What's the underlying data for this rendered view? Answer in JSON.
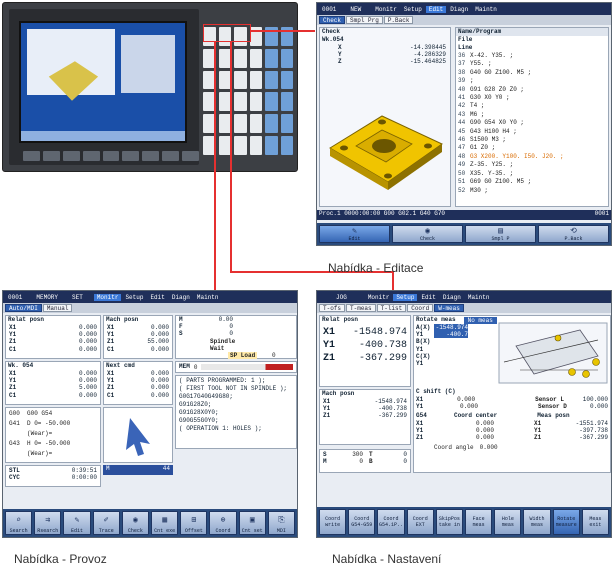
{
  "captions": {
    "edit": "Nabídka - Editace",
    "operation": "Nabídka - Provoz",
    "setup": "Nabídka - Nastavení"
  },
  "edit_screen": {
    "topbar": [
      "0001",
      "",
      "NEW",
      "",
      "Monitr",
      "Setup",
      "Edit",
      "Diagn",
      "Maintn"
    ],
    "tabs": [
      "Check",
      "Smpl Prg",
      "P.Back"
    ],
    "mode": "Check",
    "wk": "Wk.054",
    "coords": [
      {
        "axis": "X",
        "value": "-14.398445"
      },
      {
        "axis": "Y",
        "value": "-4.286329"
      },
      {
        "axis": "Z",
        "value": "-15.464825"
      }
    ],
    "file_header": "Name/Program",
    "file_label": "File",
    "line_label": "Line",
    "program_lines": [
      {
        "no": "36",
        "text": "X-42. Y35. ;"
      },
      {
        "no": "37",
        "text": "Y55. ;"
      },
      {
        "no": "38",
        "text": "G40 G0 Z100. M5 ;"
      },
      {
        "no": "39",
        "text": ";"
      },
      {
        "no": "40",
        "text": "G91 G28 Z0 Z0 ;"
      },
      {
        "no": "41",
        "text": "G30 X0 Y0 ;"
      },
      {
        "no": "42",
        "text": "T4 ;"
      },
      {
        "no": "43",
        "text": "M6 ;"
      },
      {
        "no": "44",
        "text": "G90 G54 X0 Y0 ;"
      },
      {
        "no": "45",
        "text": "G43 H100 H4 ;"
      },
      {
        "no": "46",
        "text": "S1500 M3 ;"
      },
      {
        "no": "47",
        "text": "G1 Z0 ;"
      },
      {
        "no": "48",
        "text": "G3 X200. Y100. I50. J20. ;",
        "highlight": true
      },
      {
        "no": "49",
        "text": "Z-35. Y25. ;"
      },
      {
        "no": "50",
        "text": "X35. Y-35. ;"
      },
      {
        "no": "51",
        "text": "G69 G0 Z100. M5 ;"
      },
      {
        "no": "52",
        "text": "M30 ;"
      }
    ],
    "status": "Proc.1  0000:00:00 G00 G02.1 G40 G70",
    "status_tail": "0001",
    "softkeys": [
      {
        "icon": "edit-icon",
        "label": "Edit"
      },
      {
        "icon": "check-icon",
        "label": "Check"
      },
      {
        "icon": "simple-program-icon",
        "label": "Smpl P"
      },
      {
        "icon": "playback-icon",
        "label": "P.Back"
      }
    ]
  },
  "operation_screen": {
    "topbar": [
      "0001",
      "",
      "MEMORY",
      "",
      "SET",
      "",
      "Monitr",
      "Setup",
      "Edit",
      "Diagn",
      "Maintn"
    ],
    "tabs": [
      "Auto/MDI",
      "Manual"
    ],
    "relat_title": "Relat posn",
    "relat": [
      {
        "axis": "X1",
        "value": "0.000"
      },
      {
        "axis": "Y1",
        "value": "0.000"
      },
      {
        "axis": "Z1",
        "value": "0.000"
      },
      {
        "axis": "C1",
        "value": "0.000"
      }
    ],
    "mach_title": "Mach posn",
    "mach": [
      {
        "axis": "X1",
        "value": "0.000"
      },
      {
        "axis": "Y1",
        "value": "0.000"
      },
      {
        "axis": "Z1",
        "value": "55.000"
      },
      {
        "axis": "C1",
        "value": "0.000"
      }
    ],
    "wk_title": "Wk. 054",
    "wk": [
      {
        "axis": "X1",
        "value": "0.000"
      },
      {
        "axis": "Y1",
        "value": "0.000"
      },
      {
        "axis": "Z1",
        "value": "5.000"
      },
      {
        "axis": "C1",
        "value": "0.000"
      }
    ],
    "next_title": "Next cmd",
    "next": [
      {
        "axis": "X1",
        "value": "0.000"
      },
      {
        "axis": "Y1",
        "value": "0.000"
      },
      {
        "axis": "Z1",
        "value": "0.000"
      },
      {
        "axis": "C1",
        "value": "0.000"
      }
    ],
    "feed": [
      {
        "k": "M",
        "v": "0.00"
      },
      {
        "k": "F",
        "v": "0"
      },
      {
        "k": "S",
        "v": "0"
      }
    ],
    "spindle_label": "Spindle",
    "wait_label": "Wait",
    "spload_label": "SP Load",
    "spload_value": "0",
    "mem_label": "MEM",
    "mem_value": "0",
    "modal_lines": [
      {
        "l": "G00",
        "r": "G00 G54"
      },
      {
        "l": "G41",
        "r": "D 0=   -50.000"
      },
      {
        "l": "",
        "r": "(Wear)="
      },
      {
        "l": "G43",
        "r": "H 0=   -50.000"
      },
      {
        "l": "",
        "r": "(Wear)="
      }
    ],
    "stl": {
      "label": "STL",
      "value": "0:39:51"
    },
    "cyc": {
      "label": "CYC",
      "value": "0:00:00"
    },
    "count": {
      "label": "M",
      "value": "44"
    },
    "program_text": [
      "( PARTS PROGRAMMED: 1 );",
      "( FIRST TOOL NOT IN SPINDLE );",
      "G0G17G40G49G80;",
      "G91G28Z0;",
      "G91G28X0Y0;",
      "G90G55G0Y0;",
      "( OPERATION 1: HOLES );"
    ],
    "softkeys": [
      {
        "icon": "search-icon",
        "label": "Search"
      },
      {
        "icon": "research-icon",
        "label": "Rsearch"
      },
      {
        "icon": "edit-icon",
        "label": "Edit"
      },
      {
        "icon": "trace-icon",
        "label": "Trace"
      },
      {
        "icon": "check-icon",
        "label": "Check"
      },
      {
        "icon": "cnt-exe-icon",
        "label": "Cnt exe"
      },
      {
        "icon": "offset-icon",
        "label": "Offset"
      },
      {
        "icon": "coord-icon",
        "label": "Coord"
      },
      {
        "icon": "cnt-set-icon",
        "label": "Cnt set"
      },
      {
        "icon": "mdi-icon",
        "label": "MDI"
      }
    ]
  },
  "setup_screen": {
    "topbar": [
      "",
      "",
      "JOG",
      "",
      "",
      "Monitr",
      "Setup",
      "Edit",
      "Diagn",
      "Maintn"
    ],
    "tabs": [
      "T-ofs",
      "T-meas",
      "T-list",
      "Coord",
      "W-meas"
    ],
    "relat_title": "Relat posn",
    "relat": [
      {
        "axis": "X1",
        "value": "-1548.974"
      },
      {
        "axis": "Y1",
        "value": "-400.738"
      },
      {
        "axis": "Z1",
        "value": "-367.299"
      }
    ],
    "mach_title": "Mach posn",
    "mach": [
      {
        "axis": "X1",
        "value": "-1548.974"
      },
      {
        "axis": "Y1",
        "value": "-400.738"
      },
      {
        "axis": "Z1",
        "value": "-367.299"
      }
    ],
    "rotate_title": "Rotate meas",
    "rotate_mode": "No meas",
    "rotate_rows": [
      {
        "k": "A(X)",
        "v": "-1548.974"
      },
      {
        "k": "Y1",
        "v": "-400.7"
      },
      {
        "k": "B(X)",
        "v": ""
      },
      {
        "k": "Y1",
        "v": ""
      },
      {
        "k": "C(X)",
        "v": ""
      },
      {
        "k": "Y1",
        "v": ""
      }
    ],
    "shift_title": "C shift (C)",
    "sensor_rows": [
      {
        "axis": "X1",
        "v1": "0.000",
        "label": "Sensor L",
        "v2": "100.000"
      },
      {
        "axis": "Y1",
        "v1": "0.000",
        "label": "Sensor D",
        "v2": "0.000"
      }
    ],
    "center_title": "Coord center",
    "meas_title": "Meas posn",
    "wk_label": "G54",
    "center_rows": [
      {
        "axis": "X1",
        "v1": "0.000",
        "axis2": "X1",
        "v2": "-1551.974"
      },
      {
        "axis": "Y1",
        "v1": "0.000",
        "axis2": "Y1",
        "v2": "-397.738"
      },
      {
        "axis": "Z1",
        "v1": "0.000",
        "axis2": "Z1",
        "v2": "-367.299"
      }
    ],
    "angle_label": "Coord angle",
    "angle_value": "0.000",
    "s_row": {
      "k": "S",
      "v": "300",
      "t": "T",
      "tv": "0"
    },
    "m_row": {
      "k": "M",
      "v": "0",
      "t": "B",
      "tv": "0"
    },
    "softkeys": [
      {
        "label": "Coord write"
      },
      {
        "label": "Coord G54-G59"
      },
      {
        "label": "Coord G54.1P.."
      },
      {
        "label": "Coord EXT"
      },
      {
        "label": "SkipPos take in"
      },
      {
        "label": "Face meas"
      },
      {
        "label": "Hole meas"
      },
      {
        "label": "Width meas"
      },
      {
        "label": "Rotate measure"
      },
      {
        "label": "Meas exit"
      }
    ]
  }
}
